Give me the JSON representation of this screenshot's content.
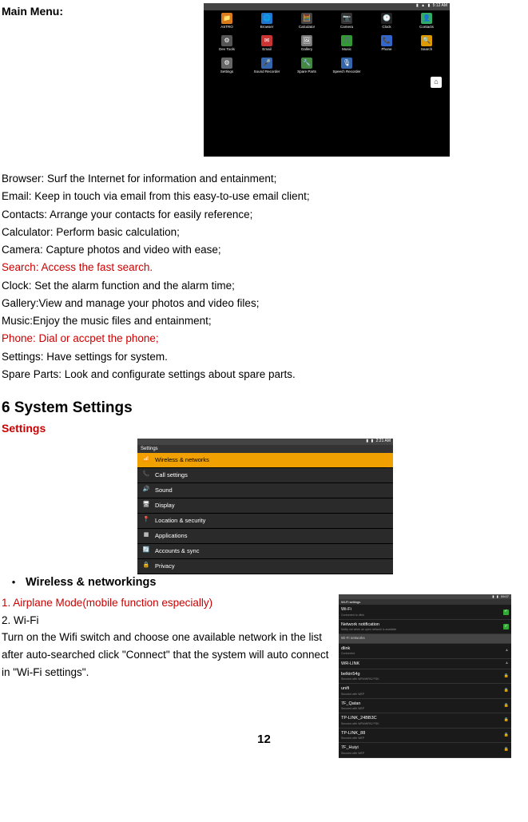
{
  "main_menu_label": "Main Menu:",
  "screenshot1": {
    "status_time": "5:12 AM",
    "apps": [
      {
        "label": "ASTRO",
        "icon": "📁",
        "bg": "#d97b1a"
      },
      {
        "label": "Browser",
        "icon": "🌐",
        "bg": "#2277cc"
      },
      {
        "label": "Calculator",
        "icon": "🧮",
        "bg": "#444"
      },
      {
        "label": "Camera",
        "icon": "📷",
        "bg": "#333"
      },
      {
        "label": "Clock",
        "icon": "🕐",
        "bg": "#222"
      },
      {
        "label": "Contacts",
        "icon": "👤",
        "bg": "#3a6"
      },
      {
        "label": "Dev Tools",
        "icon": "⚙",
        "bg": "#555"
      },
      {
        "label": "Email",
        "icon": "✉",
        "bg": "#c33"
      },
      {
        "label": "Gallery",
        "icon": "🖼",
        "bg": "#777"
      },
      {
        "label": "Music",
        "icon": "🎵",
        "bg": "#393"
      },
      {
        "label": "Phone",
        "icon": "📞",
        "bg": "#36c"
      },
      {
        "label": "Search",
        "icon": "🔍",
        "bg": "#d90"
      },
      {
        "label": "Settings",
        "icon": "⚙",
        "bg": "#666"
      },
      {
        "label": "Sound Recorder",
        "icon": "🎤",
        "bg": "#36a"
      },
      {
        "label": "Spare Parts",
        "icon": "🔧",
        "bg": "#484"
      },
      {
        "label": "Speech Recorder",
        "icon": "🎙",
        "bg": "#36a"
      }
    ]
  },
  "descriptions": [
    {
      "text": "Browser: Surf the Internet for information and entainment;",
      "red": false
    },
    {
      "text": "Email: Keep in touch via email from this easy-to-use email client;",
      "red": false
    },
    {
      "text": "Contacts: Arrange your contacts for easily reference;",
      "red": false
    },
    {
      "text": "Calculator: Perform basic calculation;",
      "red": false
    },
    {
      "text": "Camera: Capture photos and video with ease;",
      "red": false
    },
    {
      "text": "Search: Access the fast search.",
      "red": true
    },
    {
      "text": "Clock: Set the alarm function and the alarm time;",
      "red": false
    },
    {
      "text": "Gallery:View and manage your photos and video files;",
      "red": false
    },
    {
      "text": "Music:Enjoy the music files and entainment;",
      "red": false
    },
    {
      "text": "Phone: Dial or accpet the phone;",
      "red": true
    },
    {
      "text": "Settings: Have settings for system.",
      "red": false
    },
    {
      "text": "Spare Parts: Look and configurate settings about spare parts.",
      "red": false
    }
  ],
  "section6_heading": "6 System Settings",
  "settings_sub": "Settings",
  "screenshot2": {
    "status_time": "2:21 AM",
    "title": "Settings",
    "rows": [
      {
        "icon": "📶",
        "label": "Wireless & networks",
        "selected": true
      },
      {
        "icon": "📞",
        "label": "Call settings",
        "selected": false
      },
      {
        "icon": "🔊",
        "label": "Sound",
        "selected": false
      },
      {
        "icon": "🖥",
        "label": "Display",
        "selected": false
      },
      {
        "icon": "📍",
        "label": "Location & security",
        "selected": false
      },
      {
        "icon": "▦",
        "label": "Applications",
        "selected": false
      },
      {
        "icon": "🔄",
        "label": "Accounts & sync",
        "selected": false
      },
      {
        "icon": "🔒",
        "label": "Privacy",
        "selected": false
      }
    ]
  },
  "bullet_heading": "Wireless & networkings",
  "wifi_section": {
    "line1": "1. Airplane Mode(mobile function especially)",
    "line2": "2. Wi-Fi",
    "para": "Turn on the Wifi switch and choose one available network in the list after auto-searched click \"Connect\" that the system will auto connect in \"Wi-Fi settings\"."
  },
  "screenshot3": {
    "status_time": "09:07",
    "title": "Wi-Fi settings",
    "rows": [
      {
        "type": "item",
        "name": "Wi-Fi",
        "sub": "Connected to dlink",
        "check": true
      },
      {
        "type": "item",
        "name": "Network notification",
        "sub": "Notify me when an open network is available",
        "check": true
      },
      {
        "type": "header",
        "name": "Wi-Fi networks"
      },
      {
        "type": "net",
        "name": "dlink",
        "sub": "Connected",
        "lock": false
      },
      {
        "type": "net",
        "name": "WR-LINK",
        "sub": "",
        "lock": false
      },
      {
        "type": "net",
        "name": "belkin54g",
        "sub": "Secured with WPA/WPA2 PSK",
        "lock": true
      },
      {
        "type": "net",
        "name": "unifi",
        "sub": "Secured with WEP",
        "lock": true
      },
      {
        "type": "net",
        "name": "7F_Qatan",
        "sub": "Secured with WEP",
        "lock": true
      },
      {
        "type": "net",
        "name": "TP-LINK_24BB3C",
        "sub": "Secured with WPA/WPA2 PSK",
        "lock": true
      },
      {
        "type": "net",
        "name": "TP-LINK_88",
        "sub": "Secured with WEP",
        "lock": true
      },
      {
        "type": "net",
        "name": "7F_Huiyi",
        "sub": "Secured with WEP",
        "lock": true
      }
    ]
  },
  "page_number": "12"
}
